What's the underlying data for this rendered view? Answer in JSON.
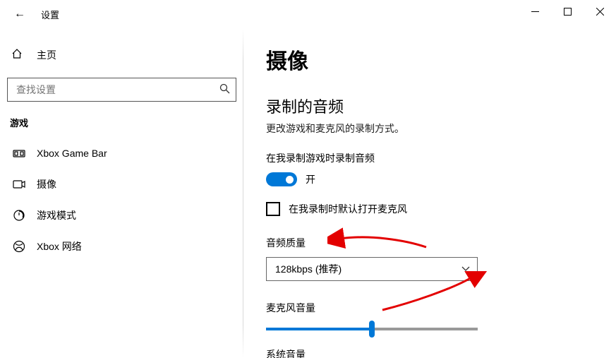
{
  "window": {
    "title": "设置"
  },
  "sidebar": {
    "home": "主页",
    "search_placeholder": "查找设置",
    "section": "游戏",
    "items": [
      {
        "label": "Xbox Game Bar",
        "icon": "gamebar"
      },
      {
        "label": "摄像",
        "icon": "capture"
      },
      {
        "label": "游戏模式",
        "icon": "gamemode"
      },
      {
        "label": "Xbox 网络",
        "icon": "xboxnet"
      }
    ]
  },
  "main": {
    "page_title": "摄像",
    "audio_heading": "录制的音频",
    "audio_desc": "更改游戏和麦克风的录制方式。",
    "record_audio_label": "在我录制游戏时录制音频",
    "toggle_state": "开",
    "mic_default_label": "在我录制时默认打开麦克风",
    "audio_quality_label": "音频质量",
    "audio_quality_value": "128kbps (推荐)",
    "mic_volume_label": "麦克风音量",
    "mic_volume_percent": 50,
    "system_volume_label": "系统音量"
  }
}
